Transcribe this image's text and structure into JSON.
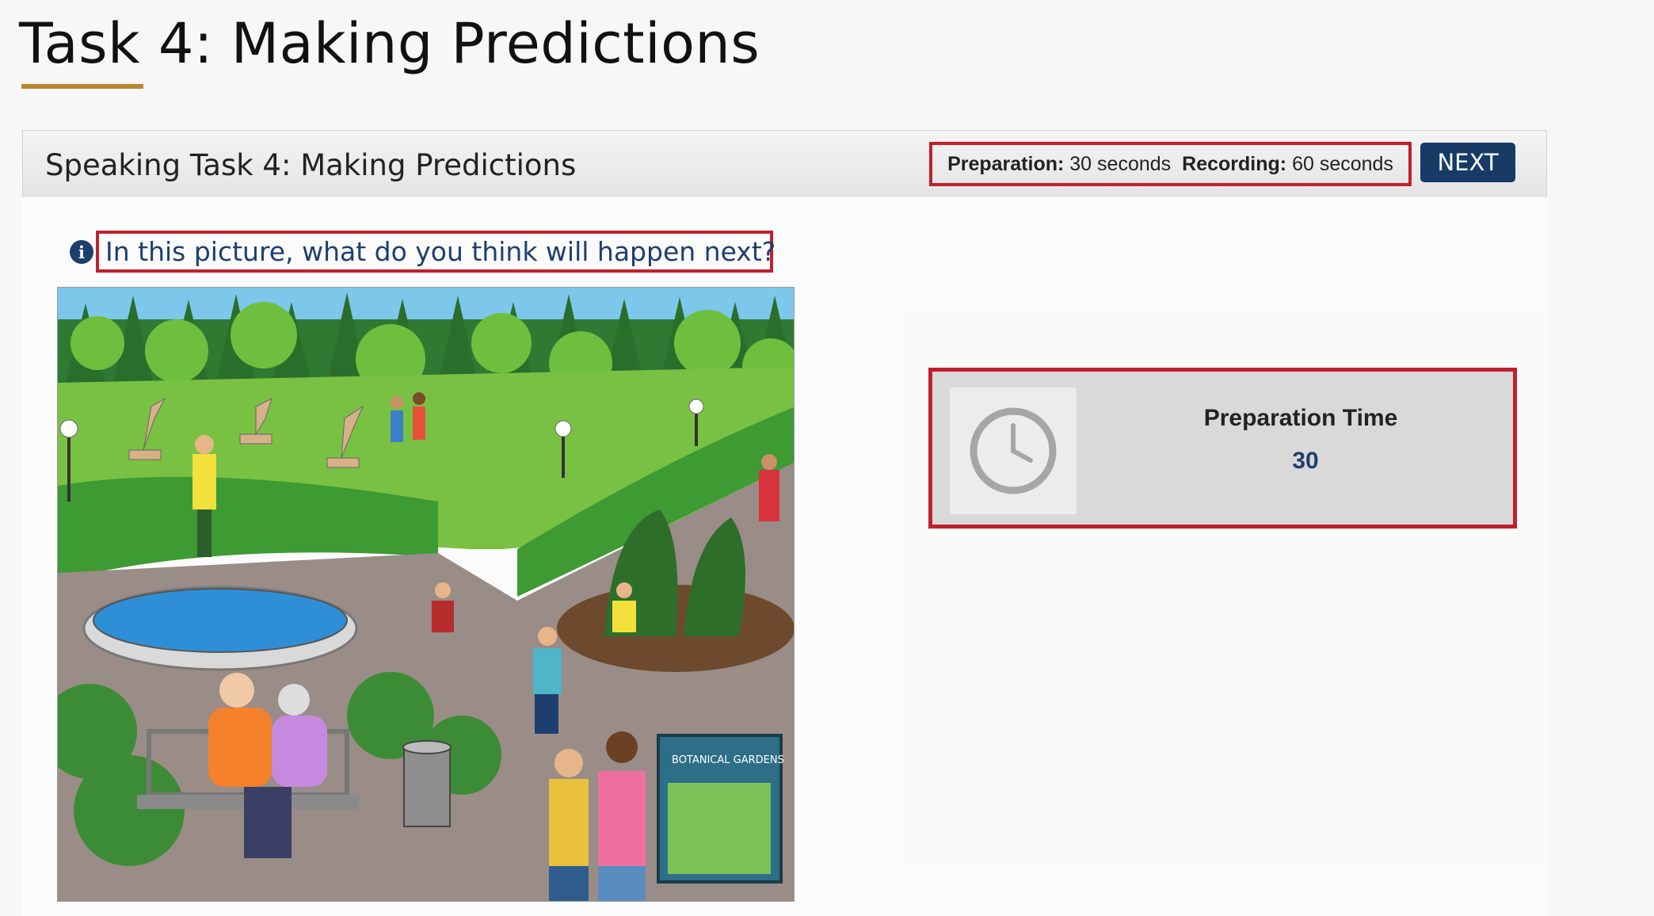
{
  "page": {
    "title": "Task 4: Making Predictions"
  },
  "task_bar": {
    "title": "Speaking Task 4: Making Predictions",
    "preparation_label": "Preparation:",
    "preparation_value": "30 seconds",
    "recording_label": "Recording:",
    "recording_value": "60 seconds",
    "next_label": "NEXT"
  },
  "question": {
    "info_icon": "i",
    "text": "In this picture, what do you think will happen next?"
  },
  "scene": {
    "sign_text": "BOTANICAL GARDENS"
  },
  "timer": {
    "label": "Preparation Time",
    "value": "30",
    "icon": "clock-icon"
  },
  "colors": {
    "accent_underline": "#b8862f",
    "highlight_border": "#c0202c",
    "navy": "#1d3f6e",
    "next_button": "#173a66"
  }
}
